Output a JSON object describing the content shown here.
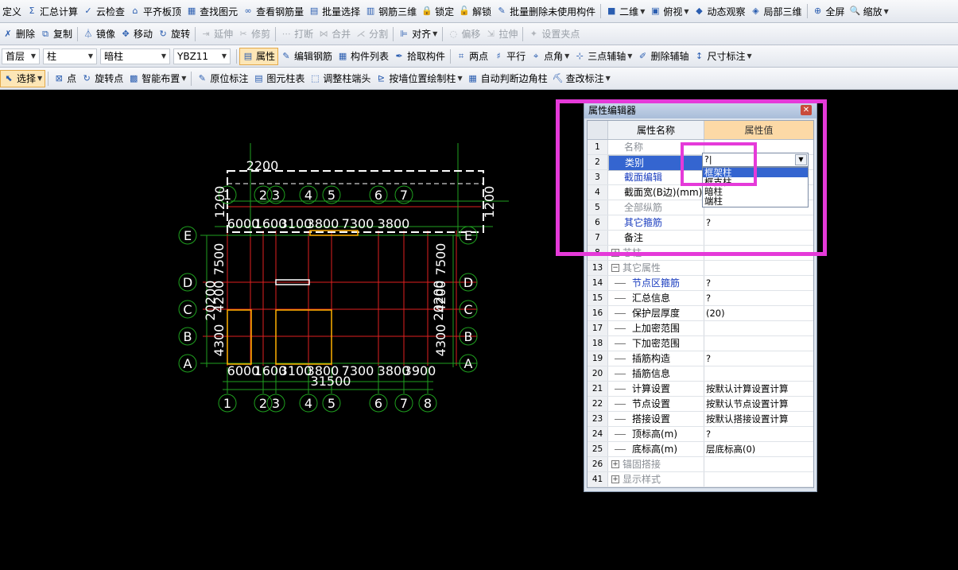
{
  "toolbar1": [
    {
      "icon": "",
      "label": "定义",
      "arrow": false
    },
    {
      "icon": "Σ",
      "label": "汇总计算",
      "arrow": false
    },
    {
      "icon": "✓",
      "label": "云检查",
      "arrow": false
    },
    {
      "icon": "⌂",
      "label": "平齐板顶",
      "arrow": false
    },
    {
      "icon": "▦",
      "label": "查找图元",
      "arrow": false
    },
    {
      "icon": "∞",
      "label": "查看钢筋量",
      "arrow": false
    },
    {
      "icon": "▤",
      "label": "批量选择",
      "arrow": false
    },
    {
      "icon": "▥",
      "label": "钢筋三维",
      "arrow": false
    },
    {
      "icon": "🔒",
      "label": "锁定",
      "arrow": false
    },
    {
      "icon": "🔓",
      "label": "解锁",
      "arrow": false
    },
    {
      "icon": "✎",
      "label": "批量删除未使用构件",
      "arrow": false
    },
    {
      "icon": "■",
      "label": "二维",
      "arrow": true
    },
    {
      "icon": "▣",
      "label": "俯视",
      "arrow": true
    },
    {
      "icon": "◆",
      "label": "动态观察",
      "arrow": false
    },
    {
      "icon": "◈",
      "label": "局部三维",
      "arrow": false
    },
    {
      "icon": "⊕",
      "label": "全屏",
      "arrow": false
    },
    {
      "icon": "🔍",
      "label": "缩放",
      "arrow": true
    }
  ],
  "toolbar2": [
    {
      "icon": "✗",
      "label": "删除",
      "disabled": false
    },
    {
      "icon": "⧉",
      "label": "复制",
      "disabled": false
    },
    {
      "icon": "⏃",
      "label": "镜像",
      "disabled": false
    },
    {
      "icon": "✥",
      "label": "移动",
      "disabled": false
    },
    {
      "icon": "↻",
      "label": "旋转",
      "disabled": false
    },
    {
      "icon": "⇥",
      "label": "延伸",
      "disabled": true
    },
    {
      "icon": "✂",
      "label": "修剪",
      "disabled": true
    },
    {
      "icon": "⋯",
      "label": "打断",
      "disabled": true
    },
    {
      "icon": "⋈",
      "label": "合并",
      "disabled": true
    },
    {
      "icon": "⋌",
      "label": "分割",
      "disabled": true
    },
    {
      "icon": "⊫",
      "label": "对齐",
      "disabled": false,
      "arrow": true
    },
    {
      "icon": "◌",
      "label": "偏移",
      "disabled": true
    },
    {
      "icon": "⇲",
      "label": "拉伸",
      "disabled": true
    },
    {
      "icon": "✦",
      "label": "设置夹点",
      "disabled": true
    }
  ],
  "toolbar3": {
    "selects": [
      {
        "value": "首层",
        "width": 48
      },
      {
        "value": "柱",
        "width": 68
      },
      {
        "value": "暗柱",
        "width": 88
      },
      {
        "value": "YBZ11",
        "width": 72
      }
    ],
    "buttons": [
      {
        "icon": "▤",
        "label": "属性",
        "pressed": true
      },
      {
        "icon": "✎",
        "label": "编辑钢筋",
        "pressed": false
      },
      {
        "icon": "▦",
        "label": "构件列表",
        "pressed": false
      },
      {
        "icon": "✒",
        "label": "拾取构件",
        "pressed": false
      },
      {
        "icon": "⌗",
        "label": "两点",
        "pressed": false
      },
      {
        "icon": "♯",
        "label": "平行",
        "pressed": false
      },
      {
        "icon": "⌖",
        "label": "点角",
        "pressed": false,
        "arrow": true
      },
      {
        "icon": "⊹",
        "label": "三点辅轴",
        "pressed": false,
        "arrow": true
      },
      {
        "icon": "✐",
        "label": "删除辅轴",
        "pressed": false
      },
      {
        "icon": "↕",
        "label": "尺寸标注",
        "pressed": false,
        "arrow": true
      }
    ]
  },
  "toolbar4": [
    {
      "icon": "⬉",
      "label": "选择",
      "pressed": true,
      "arrow": true
    },
    {
      "icon": "⊠",
      "label": "点",
      "pressed": false
    },
    {
      "icon": "↻",
      "label": "旋转点",
      "pressed": false
    },
    {
      "icon": "▩",
      "label": "智能布置",
      "pressed": false,
      "arrow": true
    },
    {
      "icon": "✎",
      "label": "原位标注",
      "pressed": false
    },
    {
      "icon": "▤",
      "label": "图元柱表",
      "pressed": false
    },
    {
      "icon": "⬚",
      "label": "调整柱端头",
      "pressed": false
    },
    {
      "icon": "⊵",
      "label": "按墙位置绘制柱",
      "pressed": false,
      "arrow": true
    },
    {
      "icon": "▦",
      "label": "自动判断边角柱",
      "pressed": false
    },
    {
      "icon": "⛏",
      "label": "查改标注",
      "pressed": false,
      "arrow": true
    }
  ],
  "drawing": {
    "grid_top_numbers": [
      "1",
      "2",
      "3",
      "4",
      "5",
      "6",
      "7"
    ],
    "grid_bottom_numbers": [
      "1",
      "2",
      "3",
      "4",
      "5",
      "6",
      "7",
      "8"
    ],
    "grid_letters": [
      "E",
      "D",
      "C",
      "B",
      "A"
    ],
    "dim_top": "2200",
    "dim_side": "1200",
    "dim_row_top": "6000",
    "dim_row_top_b": "1600",
    "dim_row_top_c": "3100",
    "dim_row_top_d": "3800",
    "dim_row_top_e": "7300",
    "dim_row_top_f": "3800",
    "dim_total": "31500",
    "dim_height": "20200",
    "dim_v1": "7500",
    "dim_v2": "4200",
    "dim_v3": "4300",
    "dim_bottom_extra": "3900"
  },
  "panel": {
    "title": "属性编辑器",
    "col_name": "属性名称",
    "col_value": "属性值",
    "rows": [
      {
        "num": "1",
        "name": "名称",
        "value": "",
        "style": "gray",
        "indent": "top"
      },
      {
        "num": "2",
        "name": "类别",
        "value": "",
        "style": "sel",
        "indent": "top"
      },
      {
        "num": "3",
        "name": "截面编辑",
        "value": "",
        "style": "blue",
        "indent": "top"
      },
      {
        "num": "4",
        "name": "截面宽(B边)(mm)",
        "value": "",
        "style": "",
        "indent": "top"
      },
      {
        "num": "5",
        "name": "全部纵筋",
        "value": "",
        "style": "gray",
        "indent": "top"
      },
      {
        "num": "6",
        "name": "其它箍筋",
        "value": "?",
        "style": "blue",
        "indent": "top"
      },
      {
        "num": "7",
        "name": "备注",
        "value": "",
        "style": "",
        "indent": "top"
      },
      {
        "num": "8",
        "name": "芯柱",
        "value": "",
        "style": "gray",
        "indent": "grp",
        "expander": "+"
      },
      {
        "num": "13",
        "name": "其它属性",
        "value": "",
        "style": "gray",
        "indent": "grp",
        "expander": "−"
      },
      {
        "num": "14",
        "name": "节点区箍筋",
        "value": "?",
        "style": "blue",
        "indent": "sub"
      },
      {
        "num": "15",
        "name": "汇总信息",
        "value": "?",
        "style": "",
        "indent": "sub"
      },
      {
        "num": "16",
        "name": "保护层厚度(mm)",
        "value": "(20)",
        "style": "",
        "indent": "sub"
      },
      {
        "num": "17",
        "name": "上加密范围(mm)",
        "value": "",
        "style": "",
        "indent": "sub"
      },
      {
        "num": "18",
        "name": "下加密范围(mm)",
        "value": "",
        "style": "",
        "indent": "sub"
      },
      {
        "num": "19",
        "name": "插筋构造",
        "value": "?",
        "style": "",
        "indent": "sub"
      },
      {
        "num": "20",
        "name": "插筋信息",
        "value": "",
        "style": "",
        "indent": "sub"
      },
      {
        "num": "21",
        "name": "计算设置",
        "value": "按默认计算设置计算",
        "style": "",
        "indent": "sub"
      },
      {
        "num": "22",
        "name": "节点设置",
        "value": "按默认节点设置计算",
        "style": "",
        "indent": "sub"
      },
      {
        "num": "23",
        "name": "搭接设置",
        "value": "按默认搭接设置计算",
        "style": "",
        "indent": "sub"
      },
      {
        "num": "24",
        "name": "顶标高(m)",
        "value": "?",
        "style": "",
        "indent": "sub"
      },
      {
        "num": "25",
        "name": "底标高(m)",
        "value": "层底标高(0)",
        "style": "",
        "indent": "sub"
      },
      {
        "num": "26",
        "name": "锚固搭接",
        "value": "",
        "style": "gray",
        "indent": "grp",
        "expander": "+"
      },
      {
        "num": "41",
        "name": "显示样式",
        "value": "",
        "style": "gray",
        "indent": "grp",
        "expander": "+"
      }
    ],
    "edit_value": "?|",
    "dropdown_items": [
      {
        "label": "框架柱",
        "highlight": true
      },
      {
        "label": "框支柱",
        "highlight": false
      },
      {
        "label": "暗柱",
        "highlight": false
      },
      {
        "label": "端柱",
        "highlight": false
      }
    ]
  },
  "colors": {
    "annotation_highlight": "#e53ad9",
    "axis_grid": "#e02020",
    "axis_line": "#1fa01f",
    "column_outline": "#ffb000",
    "text_white": "#ffffff"
  }
}
